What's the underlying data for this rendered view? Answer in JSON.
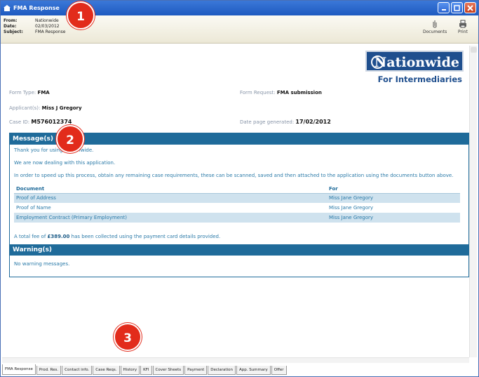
{
  "window": {
    "title": "FMA Response"
  },
  "header": {
    "from_label": "From:",
    "from_value": "Nationwide",
    "date_label": "Date:",
    "date_value": "02/03/2012",
    "subject_label": "Subject:",
    "subject_value": "FMA Response",
    "documents_label": "Documents",
    "print_label": "Print"
  },
  "logo": {
    "brand": "Nationwide",
    "sub": "For Intermediaries"
  },
  "form": {
    "form_type_label": "Form Type:",
    "form_type_value": "FMA",
    "form_request_label": "Form Request:",
    "form_request_value": "FMA submission",
    "applicants_label": "Applicant(s):",
    "applicants_value": "Miss J Gregory",
    "case_id_label": "Case ID:",
    "case_id_value": "M576012374",
    "date_generated_label": "Date page generated:",
    "date_generated_value": "17/02/2012"
  },
  "messages": {
    "heading": "Message(s)",
    "line1": "Thank you for using Nationwide.",
    "line2": "We are now dealing with this application.",
    "line3": "In order to speed up this process, obtain any remaining case requirements, these can be scanned, saved and then attached to the application using the documents button above.",
    "col_document": "Document",
    "col_for": "For",
    "rows": [
      {
        "document": "Proof of Address",
        "for": "Miss Jane Gregory"
      },
      {
        "document": "Proof of Name",
        "for": "Miss Jane Gregory"
      },
      {
        "document": "Employment Contract (Primary Employment)",
        "for": "Miss Jane Gregory"
      }
    ],
    "fee_prefix": "A total fee of ",
    "fee_amount": "£389.00",
    "fee_suffix": " has been collected using the payment card details provided."
  },
  "warnings": {
    "heading": "Warning(s)",
    "text": "No warning messages."
  },
  "tabs": [
    "FMA Response",
    "Prod. Res.",
    "Contact info.",
    "Case Reqs.",
    "History",
    "KFI",
    "Cover Sheets",
    "Payment",
    "Declaration",
    "App. Summary",
    "Offer"
  ],
  "active_tab": "FMA Response",
  "callouts": [
    "1",
    "2",
    "3"
  ],
  "colors": {
    "accent": "#1f6b9a",
    "brand": "#1f4f8e",
    "callout": "#e22b1b"
  }
}
